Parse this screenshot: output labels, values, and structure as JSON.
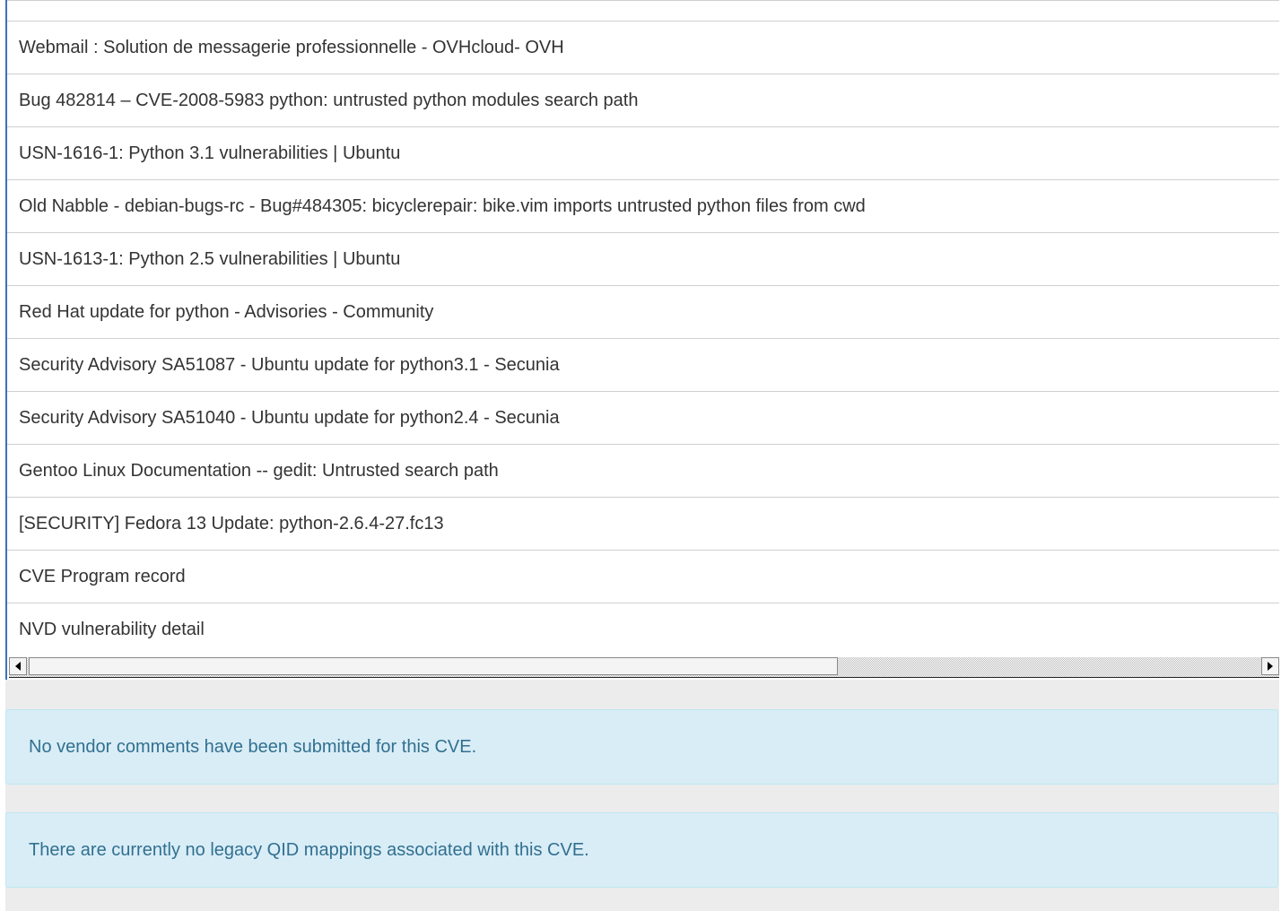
{
  "references": {
    "rows": [
      "Webmail : Solution de messagerie professionnelle - OVHcloud- OVH",
      "Bug 482814 – CVE-2008-5983 python: untrusted python modules search path",
      "USN-1616-1: Python 3.1 vulnerabilities | Ubuntu",
      "Old Nabble - debian-bugs-rc - Bug#484305: bicyclerepair: bike.vim imports untrusted python files from cwd",
      "USN-1613-1: Python 2.5 vulnerabilities | Ubuntu",
      "Red Hat update for python - Advisories - Community",
      "Security Advisory SA51087 - Ubuntu update for python3.1 - Secunia",
      "Security Advisory SA51040 - Ubuntu update for python2.4 - Secunia",
      "Gentoo Linux Documentation -- gedit: Untrusted search path",
      "[SECURITY] Fedora 13 Update: python-2.6.4-27.fc13",
      "CVE Program record",
      "NVD vulnerability detail"
    ]
  },
  "vendor_comments": {
    "message": "No vendor comments have been submitted for this CVE."
  },
  "qid_mappings": {
    "message": "There are currently no legacy QID mappings associated with this CVE."
  },
  "icons": {
    "scroll_left": "arrow-left-icon",
    "scroll_right": "arrow-right-icon"
  },
  "colors": {
    "alert_bg": "#d9edf7",
    "alert_text": "#31708f",
    "accent_border": "#3b73b9"
  }
}
